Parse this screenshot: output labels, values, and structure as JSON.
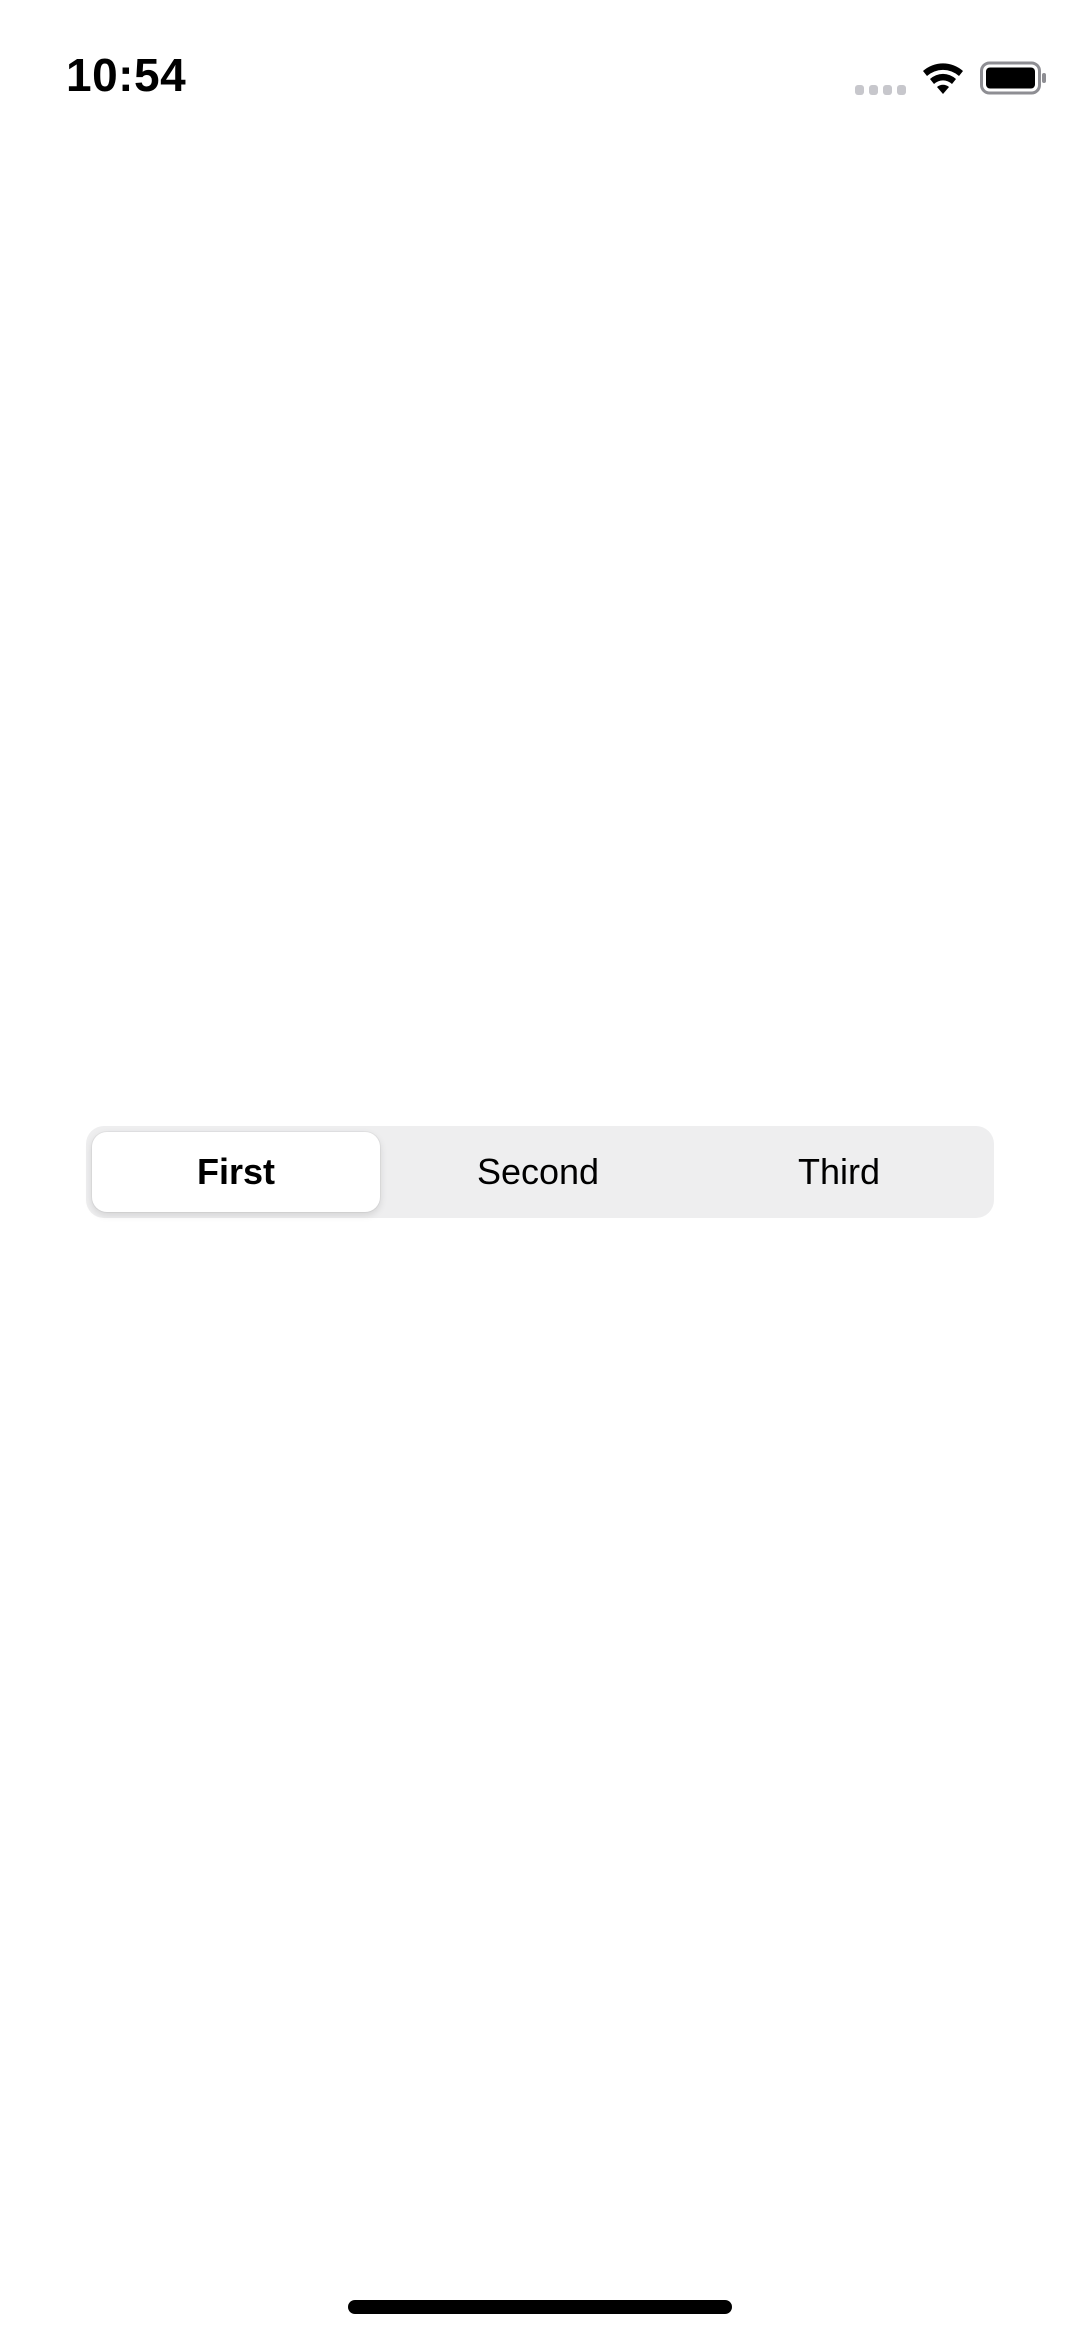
{
  "status_bar": {
    "time": "10:54",
    "icons": {
      "signal": "cellular-signal-icon",
      "wifi": "wifi-icon",
      "battery": "battery-icon"
    }
  },
  "segmented_control": {
    "segments": [
      {
        "label": "First",
        "selected": true
      },
      {
        "label": "Second",
        "selected": false
      },
      {
        "label": "Third",
        "selected": false
      }
    ]
  },
  "colors": {
    "background": "#ffffff",
    "segment_track": "#eeeeef",
    "selected_segment": "#ffffff",
    "text": "#000000",
    "inactive_signal": "#c7c7cc"
  }
}
